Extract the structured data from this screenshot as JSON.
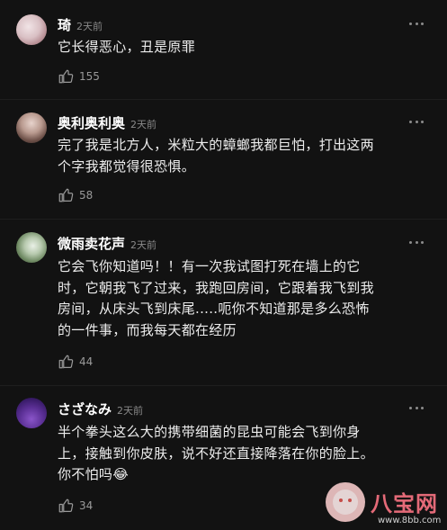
{
  "comments": [
    {
      "user": "琦",
      "time": "2天前",
      "lines": [
        "它长得恶心，丑是原罪"
      ],
      "likes": "155"
    },
    {
      "user": "奥利奥利奥",
      "time": "2天前",
      "lines": [
        "完了我是北方人，米粒大的蟑螂我都巨怕，打出这两",
        "个字我都觉得很恐惧。"
      ],
      "likes": "58"
    },
    {
      "user": "微雨卖花声",
      "time": "2天前",
      "lines": [
        "它会飞你知道吗！！有一次我试图打死在墙上的它",
        "时，它朝我飞了过来，我跑回房间，它跟着我飞到我",
        "房间，从床头飞到床尾.....呃你不知道那是多么恐怖",
        "的一件事，而我每天都在经历"
      ],
      "likes": "44"
    },
    {
      "user": "さざなみ",
      "time": "2天前",
      "lines": [
        "半个拳头这么大的携带细菌的昆虫可能会飞到你身",
        "上，接触到你皮肤，说不好还直接降落在你的脸上。",
        "你不怕吗😂"
      ],
      "likes": "34"
    }
  ],
  "watermark": {
    "brand": "八宝网",
    "url": "www.8bb.com"
  }
}
